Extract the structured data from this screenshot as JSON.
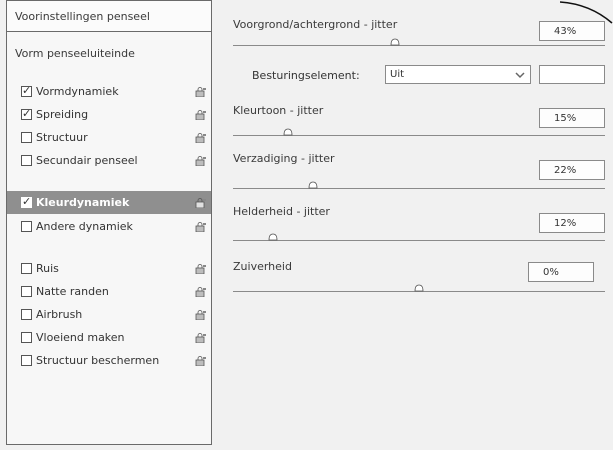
{
  "left_panel": {
    "preset_button_label": "Voorinstellingen penseel",
    "brush_tip_label": "Vorm penseeluiteinde",
    "options": [
      {
        "label": "Vormdynamiek",
        "checked": true,
        "selected": false
      },
      {
        "label": "Spreiding",
        "checked": true,
        "selected": false
      },
      {
        "label": "Structuur",
        "checked": false,
        "selected": false
      },
      {
        "label": "Secundair penseel",
        "checked": false,
        "selected": false
      },
      {
        "label": "Kleurdynamiek",
        "checked": true,
        "selected": true
      },
      {
        "label": "Andere dynamiek",
        "checked": false,
        "selected": false
      },
      {
        "label": "Ruis",
        "checked": false,
        "selected": false
      },
      {
        "label": "Natte randen",
        "checked": false,
        "selected": false
      },
      {
        "label": "Airbrush",
        "checked": false,
        "selected": false
      },
      {
        "label": "Vloeiend maken",
        "checked": false,
        "selected": false
      },
      {
        "label": "Structuur beschermen",
        "checked": false,
        "selected": false
      }
    ]
  },
  "right_panel": {
    "fg_bg_jitter": {
      "label": "Voorgrond/achtergrond - jitter",
      "value": "43%",
      "level": 0.43
    },
    "control": {
      "label": "Besturingselement:",
      "value": "Uit"
    },
    "hue_jitter": {
      "label": "Kleurtoon - jitter",
      "value": "15%",
      "level": 0.15
    },
    "saturation_jitter": {
      "label": "Verzadiging - jitter",
      "value": "22%",
      "level": 0.22
    },
    "brightness_jitter": {
      "label": "Helderheid - jitter",
      "value": "12%",
      "level": 0.12
    },
    "purity": {
      "label": "Zuiverheid",
      "value": "0%",
      "level": 0.5
    }
  },
  "colors": {
    "selected_row": "#8f8f8f",
    "panel_bg": "#f1f1f1",
    "border": "#6a6a6a"
  }
}
